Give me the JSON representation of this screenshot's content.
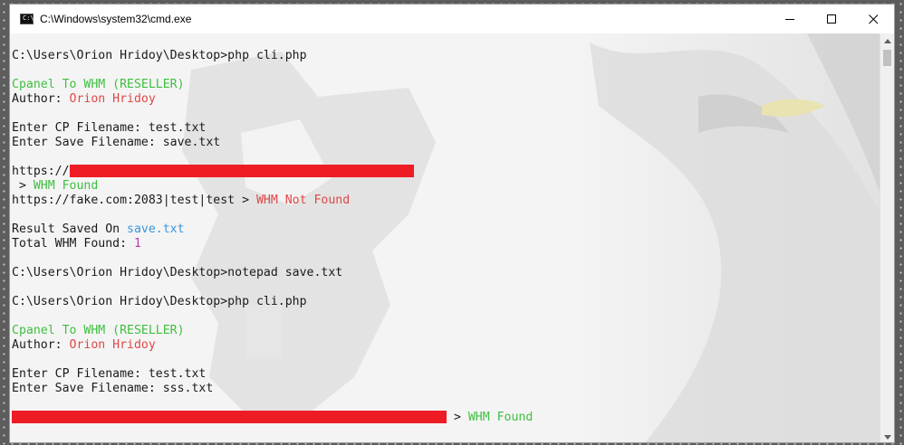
{
  "window": {
    "title": "C:\\Windows\\system32\\cmd.exe",
    "app_icon_text": "C:\\"
  },
  "console": {
    "lines": [
      {
        "parts": []
      },
      {
        "parts": [
          {
            "t": "C:\\Users\\Orion Hridoy\\Desktop>php cli.php",
            "c": ""
          }
        ]
      },
      {
        "parts": []
      },
      {
        "parts": [
          {
            "t": "Cpanel To WHM (RESELLER)",
            "c": "green"
          }
        ]
      },
      {
        "parts": [
          {
            "t": "Author: ",
            "c": ""
          },
          {
            "t": "Orion Hridoy",
            "c": "red"
          }
        ]
      },
      {
        "parts": []
      },
      {
        "parts": [
          {
            "t": "Enter CP Filename: test.txt",
            "c": ""
          }
        ]
      },
      {
        "parts": [
          {
            "t": "Enter Save Filename: save.txt",
            "c": ""
          }
        ]
      },
      {
        "parts": []
      },
      {
        "parts": [
          {
            "t": "https://",
            "c": ""
          },
          {
            "redact": 380
          }
        ]
      },
      {
        "parts": [
          {
            "t": " > ",
            "c": ""
          },
          {
            "t": "WHM Found",
            "c": "green"
          }
        ]
      },
      {
        "parts": [
          {
            "t": "https://fake.com:2083|test|test > ",
            "c": ""
          },
          {
            "t": "WHM Not Found",
            "c": "red"
          }
        ]
      },
      {
        "parts": []
      },
      {
        "parts": [
          {
            "t": "Result Saved On ",
            "c": ""
          },
          {
            "t": "save.txt",
            "c": "blue"
          }
        ]
      },
      {
        "parts": [
          {
            "t": "Total WHM Found: ",
            "c": ""
          },
          {
            "t": "1",
            "c": "magenta"
          }
        ]
      },
      {
        "parts": []
      },
      {
        "parts": [
          {
            "t": "C:\\Users\\Orion Hridoy\\Desktop>notepad save.txt",
            "c": ""
          }
        ]
      },
      {
        "parts": []
      },
      {
        "parts": [
          {
            "t": "C:\\Users\\Orion Hridoy\\Desktop>php cli.php",
            "c": ""
          }
        ]
      },
      {
        "parts": []
      },
      {
        "parts": [
          {
            "t": "Cpanel To WHM (RESELLER)",
            "c": "green"
          }
        ]
      },
      {
        "parts": [
          {
            "t": "Author: ",
            "c": ""
          },
          {
            "t": "Orion Hridoy",
            "c": "red"
          }
        ]
      },
      {
        "parts": []
      },
      {
        "parts": [
          {
            "t": "Enter CP Filename: test.txt",
            "c": ""
          }
        ]
      },
      {
        "parts": [
          {
            "t": "Enter Save Filename: sss.txt",
            "c": ""
          }
        ]
      },
      {
        "parts": []
      },
      {
        "parts": [
          {
            "redact": 480
          },
          {
            "t": " > ",
            "c": ""
          },
          {
            "t": "WHM Found",
            "c": "green"
          }
        ]
      }
    ]
  },
  "colors": {
    "green": "#3fbf3f",
    "red": "#e04848",
    "blue": "#3a96dd",
    "magenta": "#b33cb3",
    "redaction": "#ee1c24"
  },
  "icons": {
    "minimize": "minimize-icon",
    "maximize": "maximize-icon",
    "close": "close-icon",
    "scroll_up": "scroll-up-icon",
    "scroll_down": "scroll-down-icon"
  }
}
